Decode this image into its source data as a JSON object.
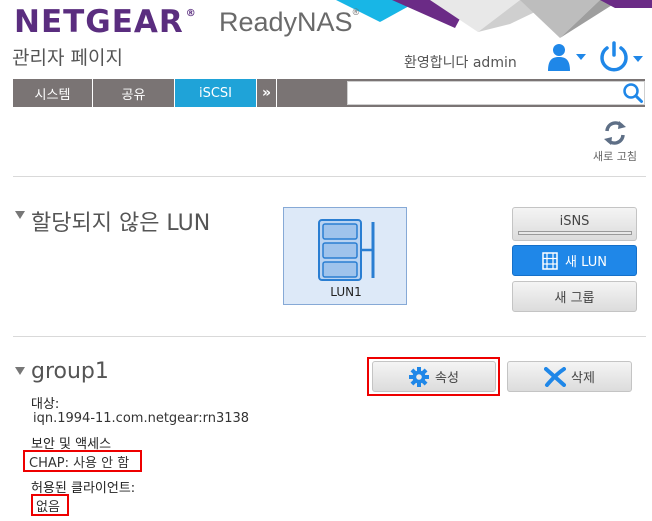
{
  "header": {
    "brand": "NETGEAR",
    "brand_mark": "®",
    "product": "ReadyNAS",
    "product_mark": "®",
    "admin_title": "관리자 페이지",
    "welcome": "환영합니다 admin",
    "user_icon": "user-icon",
    "power_icon": "power-icon"
  },
  "nav": {
    "tabs": [
      "시스템",
      "공유",
      "iSCSI"
    ],
    "active": "iSCSI",
    "more": "»",
    "search_placeholder": ""
  },
  "refresh": {
    "label": "새로 고침",
    "icon": "refresh-icon"
  },
  "unassigned": {
    "title": "할당되지 않은 LUN",
    "lun_name": "LUN1",
    "isns_label": "iSNS",
    "new_lun_label": "새 LUN",
    "new_group_label": "새 그룹"
  },
  "group": {
    "name": "group1",
    "properties_label": "속성",
    "delete_label": "삭제",
    "target_label": "대상:",
    "target_value": "iqn.1994-11.com.netgear:rn3138",
    "security_label": "보안 및 액세스",
    "security_value": "CHAP: 사용 안 함",
    "clients_label": "허용된 클라이언트:",
    "clients_value": "없음"
  },
  "colors": {
    "brand": "#5a2d7f",
    "active_tab": "#1fa3d8",
    "primary_button": "#1f87e8",
    "highlight": "#e00000"
  }
}
